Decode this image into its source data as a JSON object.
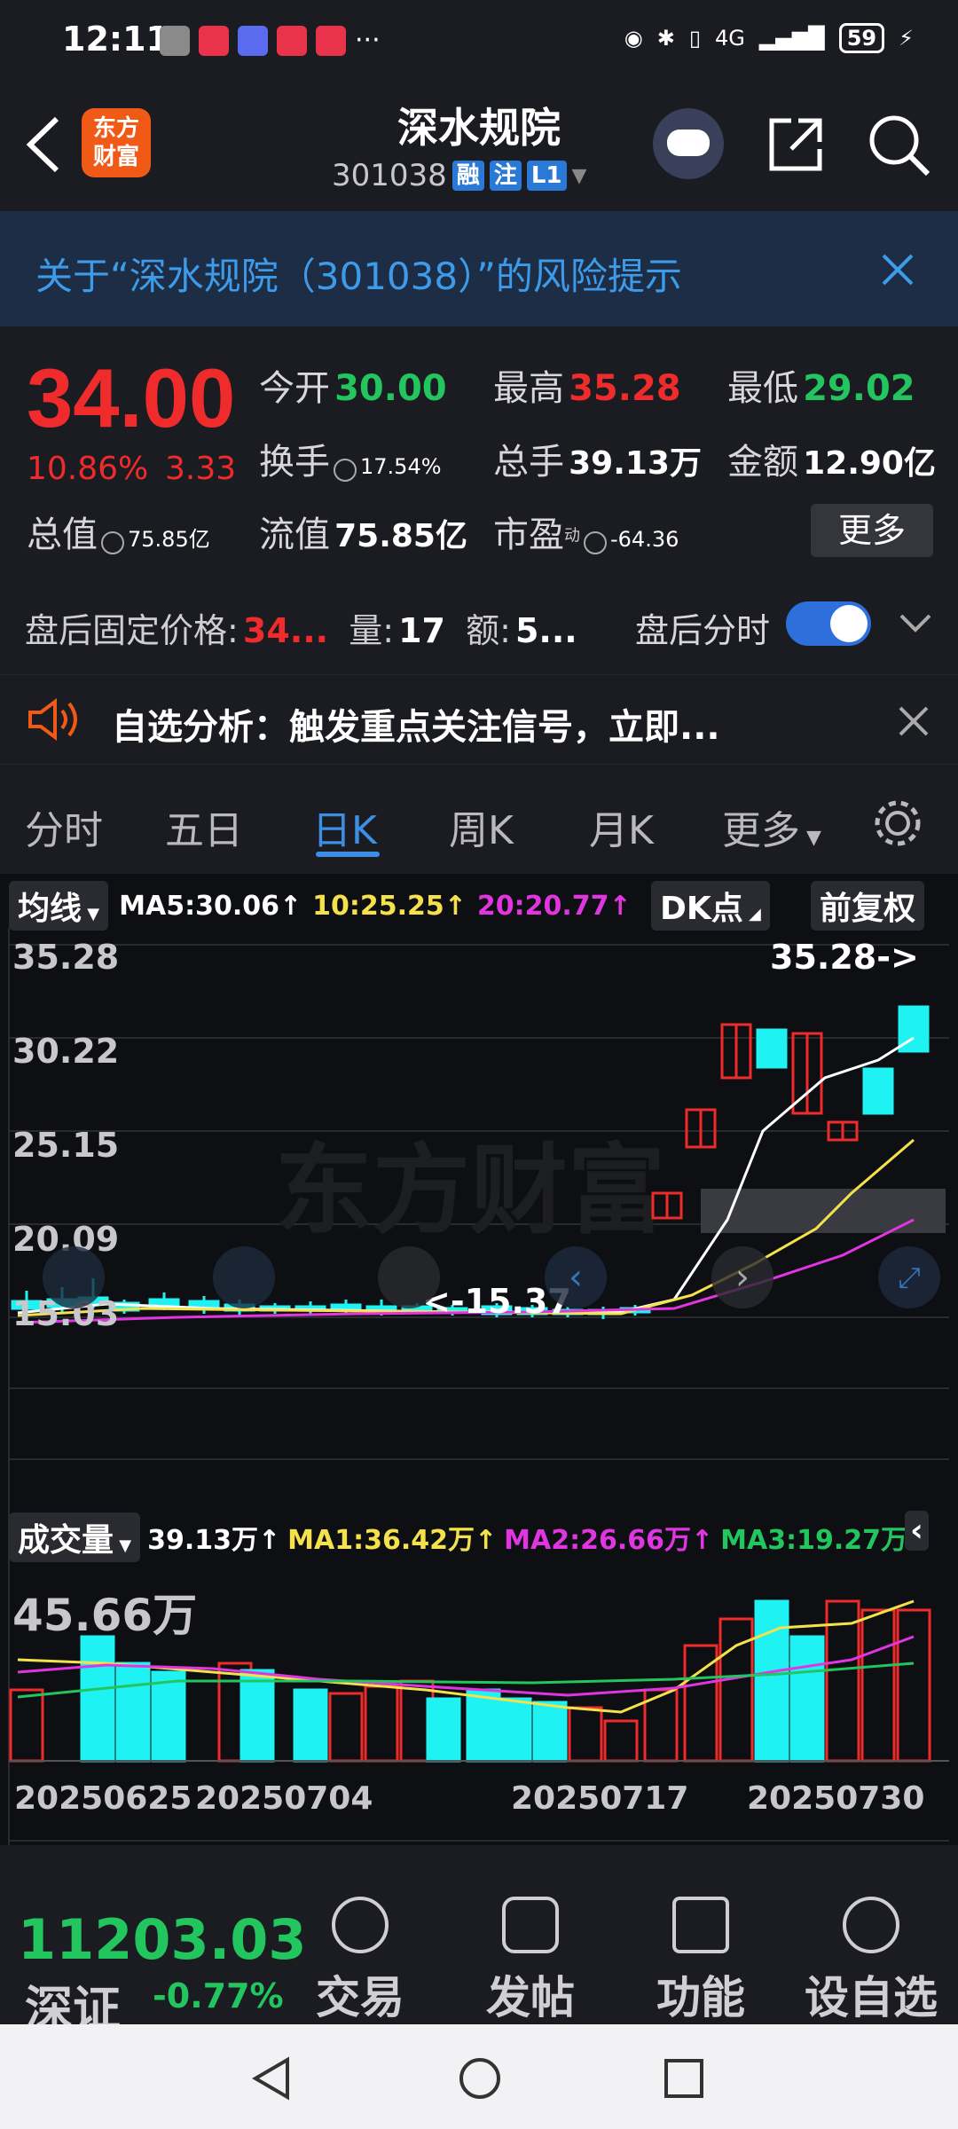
{
  "status_bar": {
    "time": "12:11",
    "ellipsis": "···",
    "network": "4G",
    "battery": "59"
  },
  "header": {
    "logo_text": "东方\n财富",
    "stock_name": "深水规院",
    "code": "301038",
    "tags": [
      "融",
      "注",
      "L1"
    ]
  },
  "risk_banner": {
    "text": "关于“深水规院（301038）”的风险提示"
  },
  "quote": {
    "price": "34.00",
    "change_pct": "10.86%",
    "change_amt": "3.33",
    "open_label": "今开",
    "open": "30.00",
    "high_label": "最高",
    "high": "35.28",
    "low_label": "最低",
    "low": "29.02",
    "turnover_label": "换手",
    "turnover": "17.54%",
    "volume_label": "总手",
    "volume": "39.13万",
    "amount_label": "金额",
    "amount": "12.90亿",
    "mktcap_label": "总值",
    "mktcap": "75.85亿",
    "float_label": "流值",
    "float": "75.85亿",
    "pe_label": "市盈",
    "pe_sup": "动",
    "pe": "-64.36",
    "more": "更多"
  },
  "after_hours": {
    "price_label": "盘后固定价格:",
    "price": "34...",
    "vol_label": "量:",
    "vol": "17",
    "amt_label": "额:",
    "amt": "5...",
    "intraday_label": "盘后分时",
    "toggle_on": true
  },
  "analysis": {
    "text": "自选分析：触发重点关注信号，立即..."
  },
  "tabs": [
    "分时",
    "五日",
    "日K",
    "周K",
    "月K",
    "更多"
  ],
  "active_tab": "日K",
  "kline": {
    "ma_chip": "均线",
    "ma5": "MA5:30.06↑",
    "ma10": "10:25.25↑",
    "ma20": "20:20.77↑",
    "dk_chip": "DK点",
    "adj_chip": "前复权",
    "y_labels": [
      "35.28",
      "30.22",
      "25.15",
      "20.09",
      "15.03"
    ],
    "high_marker": "35.28->",
    "low_marker": "<-15.37",
    "watermark": "东方财富"
  },
  "volume": {
    "chip": "成交量",
    "vol": "39.13万↑",
    "ma1": "MA1:36.42万↑",
    "ma2": "MA2:26.66万↑",
    "ma3": "MA3:19.27万↑",
    "max_label": "45.66万",
    "dates": [
      "20250625",
      "20250704",
      "20250717",
      "20250730"
    ]
  },
  "colors": {
    "up": "#f02b2b",
    "down": "#1ff2f2",
    "ma5": "#ffffff",
    "ma10": "#f5e14b",
    "ma20": "#e135e1",
    "ma3": "#22c55e",
    "accent": "#3d8fe6"
  },
  "bottom_bar": {
    "index_value": "11203.03",
    "index_name": "深证",
    "index_change": "-0.77%",
    "items": [
      {
        "label": "交易",
        "icon": "trade-icon"
      },
      {
        "label": "发帖",
        "icon": "post-icon"
      },
      {
        "label": "功能",
        "icon": "function-icon"
      },
      {
        "label": "设自选",
        "icon": "add-watchlist-icon"
      }
    ]
  }
}
